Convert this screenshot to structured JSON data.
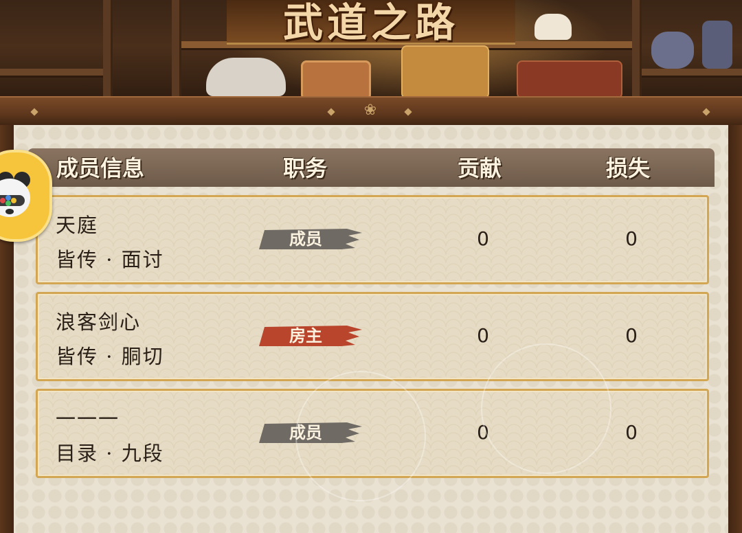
{
  "title": "武道之路",
  "table": {
    "headers": [
      "成员信息",
      "职务",
      "贡献",
      "损失"
    ],
    "rows": [
      {
        "name": "天庭",
        "rank": "皆传 · 面讨",
        "role": "成员",
        "role_type": "member",
        "contribution": "0",
        "loss": "0"
      },
      {
        "name": "浪客剑心",
        "rank": "皆传 · 胴切",
        "role": "房主",
        "role_type": "owner",
        "contribution": "0",
        "loss": "0"
      },
      {
        "name": "一一一",
        "rank": "目录 · 九段",
        "role": "成员",
        "role_type": "member",
        "contribution": "0",
        "loss": "0"
      }
    ]
  },
  "colors": {
    "member_badge": "#6f6a63",
    "owner_badge": "#b9452c",
    "row_border": "#d2a652",
    "header_bg": "#7a6553"
  },
  "avatar": {
    "icon": "panda-face-icon"
  }
}
